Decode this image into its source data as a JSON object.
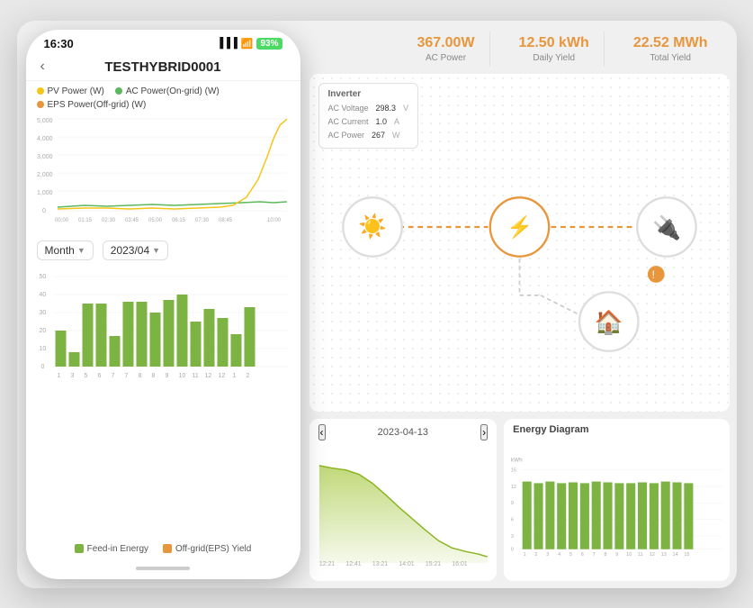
{
  "app": {
    "time": "16:30",
    "battery": "93%",
    "title": "TESTHYBRID0001"
  },
  "stats": [
    {
      "value": "367.00W",
      "label": "AC Power"
    },
    {
      "value": "12.50 kWh",
      "label": "Daily Yield"
    },
    {
      "value": "22.52 MWh",
      "label": "Total Yield"
    }
  ],
  "inverter": {
    "title": "Inverter",
    "rows": [
      {
        "label": "AC Voltage",
        "value": "298.3",
        "unit": "V"
      },
      {
        "label": "AC Current",
        "value": "1.0",
        "unit": "A"
      },
      {
        "label": "AC Power",
        "value": "267",
        "unit": "W"
      }
    ]
  },
  "legend": {
    "pv": "PV Power (W)",
    "ac": "AC Power(On-grid) (W)",
    "eps": "EPS Power(Off-grid) (W)"
  },
  "monthSelector": {
    "period": "Month",
    "date": "2023/04"
  },
  "xAxisLabels": [
    "00:00",
    "01:15",
    "02:30",
    "03:45",
    "05:00",
    "06:15",
    "07:30",
    "08:45",
    "10:00"
  ],
  "yAxisLabels": [
    "5,000",
    "4,000",
    "3,000",
    "2,000",
    "1,000",
    "0"
  ],
  "barChartYLabels": [
    "50",
    "40",
    "30",
    "20",
    "10",
    "0"
  ],
  "barChartXLabels": [
    "1",
    "3",
    "5",
    "6",
    "7",
    "8",
    "9",
    "10",
    "11",
    "12"
  ],
  "bottomLegend": {
    "feedin": "Feed-in Energy",
    "offgrid": "Off-grid(EPS) Yield"
  },
  "flowDate": "2023-04-13",
  "energyDiagramTitle": "Energy Diagram",
  "energyDiagramYLabel": "kWh",
  "energyDiagramYValues": [
    "15",
    "12",
    "9",
    "6",
    "3",
    "0"
  ],
  "energyDiagramXLabels": [
    "1",
    "2",
    "3",
    "4",
    "5",
    "6",
    "7",
    "8",
    "9",
    "10",
    "11",
    "12",
    "13",
    "14",
    "15"
  ],
  "colors": {
    "pv": "#f5c518",
    "ac": "#5cb85c",
    "eps": "#e8963c",
    "feedin": "#7cb342",
    "offgrid": "#e8963c",
    "accent": "#e8963c",
    "bar": "#7cb342"
  },
  "nodes": [
    {
      "id": "solar",
      "icon": "☀",
      "label": ""
    },
    {
      "id": "inverter",
      "icon": "⚡",
      "label": ""
    },
    {
      "id": "grid",
      "icon": "🔌",
      "label": ""
    },
    {
      "id": "home",
      "icon": "🏠",
      "label": ""
    }
  ],
  "back_label": "‹"
}
